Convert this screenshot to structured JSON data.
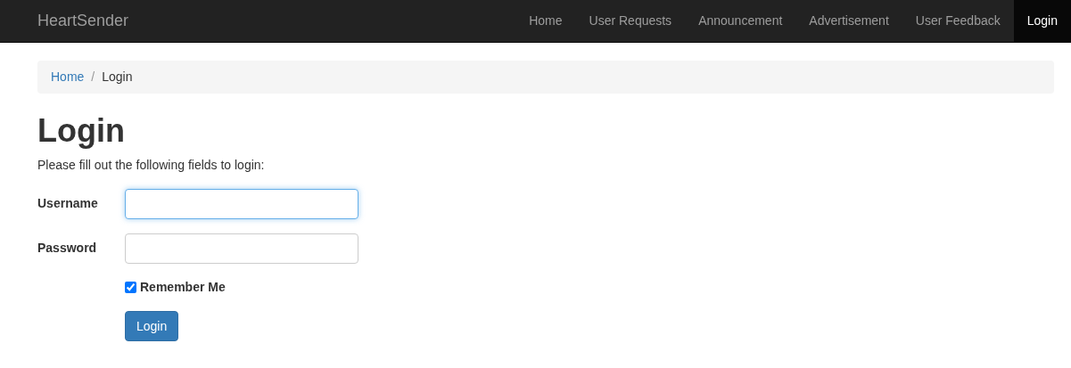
{
  "brand": "HeartSender",
  "nav": [
    {
      "label": "Home",
      "selected": false
    },
    {
      "label": "User Requests",
      "selected": false
    },
    {
      "label": "Announcement",
      "selected": false
    },
    {
      "label": "Advertisement",
      "selected": false
    },
    {
      "label": "User Feedback",
      "selected": false
    },
    {
      "label": "Login",
      "selected": true
    }
  ],
  "breadcrumb_separator": "/",
  "breadcrumb": [
    {
      "label": "Home",
      "kind": "link"
    },
    {
      "label": "Login",
      "kind": "current"
    }
  ],
  "heading": "Login",
  "intro": "Please fill out the following fields to login:",
  "fields": [
    {
      "label": "Username",
      "focused": true
    },
    {
      "label": "Password",
      "focused": false
    }
  ],
  "remember": {
    "label": "Remember Me",
    "checked": true
  },
  "submit": "Login"
}
